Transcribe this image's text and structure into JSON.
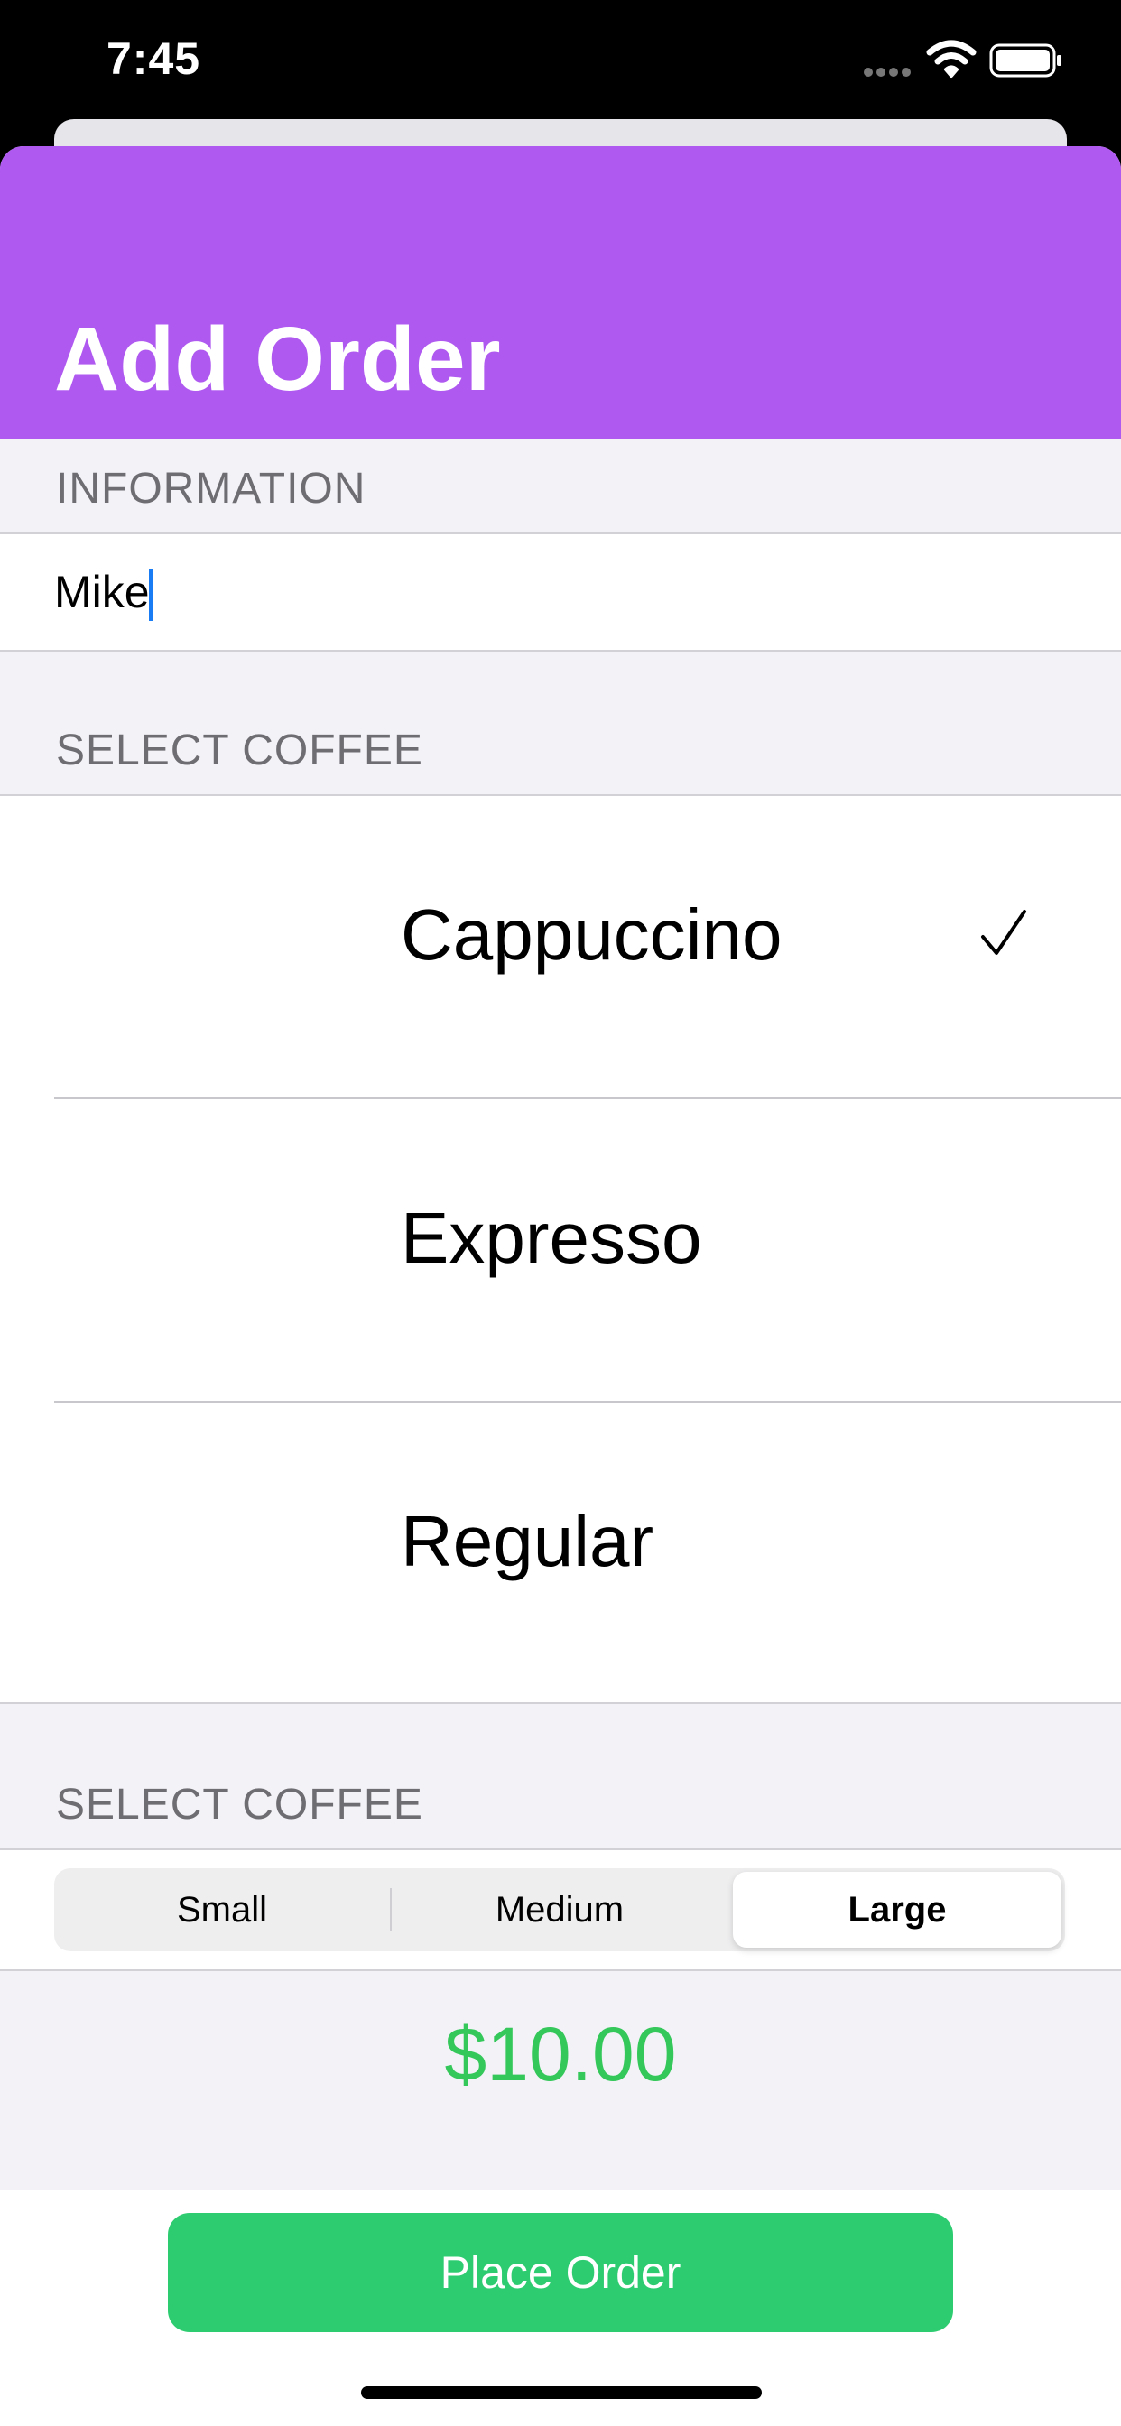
{
  "status_bar": {
    "time": "7:45",
    "signal_icon": "signal-dots-icon",
    "wifi_icon": "wifi-icon",
    "battery_icon": "battery-icon"
  },
  "header": {
    "title": "Add Order",
    "color": "#af59f0"
  },
  "information": {
    "section_title": "INFORMATION",
    "name_value": "Mike",
    "name_placeholder": ""
  },
  "coffee": {
    "section_title": "SELECT COFFEE",
    "options": [
      {
        "label": "Cappuccino",
        "selected": true
      },
      {
        "label": "Expresso",
        "selected": false
      },
      {
        "label": "Regular",
        "selected": false
      }
    ],
    "selected_icon": "checkmark-icon"
  },
  "size": {
    "section_title": "SELECT COFFEE",
    "segments": [
      "Small",
      "Medium",
      "Large"
    ],
    "selected": "Large"
  },
  "order": {
    "price": "$10.00",
    "price_color": "#34c759",
    "button_label": "Place Order",
    "button_color": "#2ecc71"
  }
}
